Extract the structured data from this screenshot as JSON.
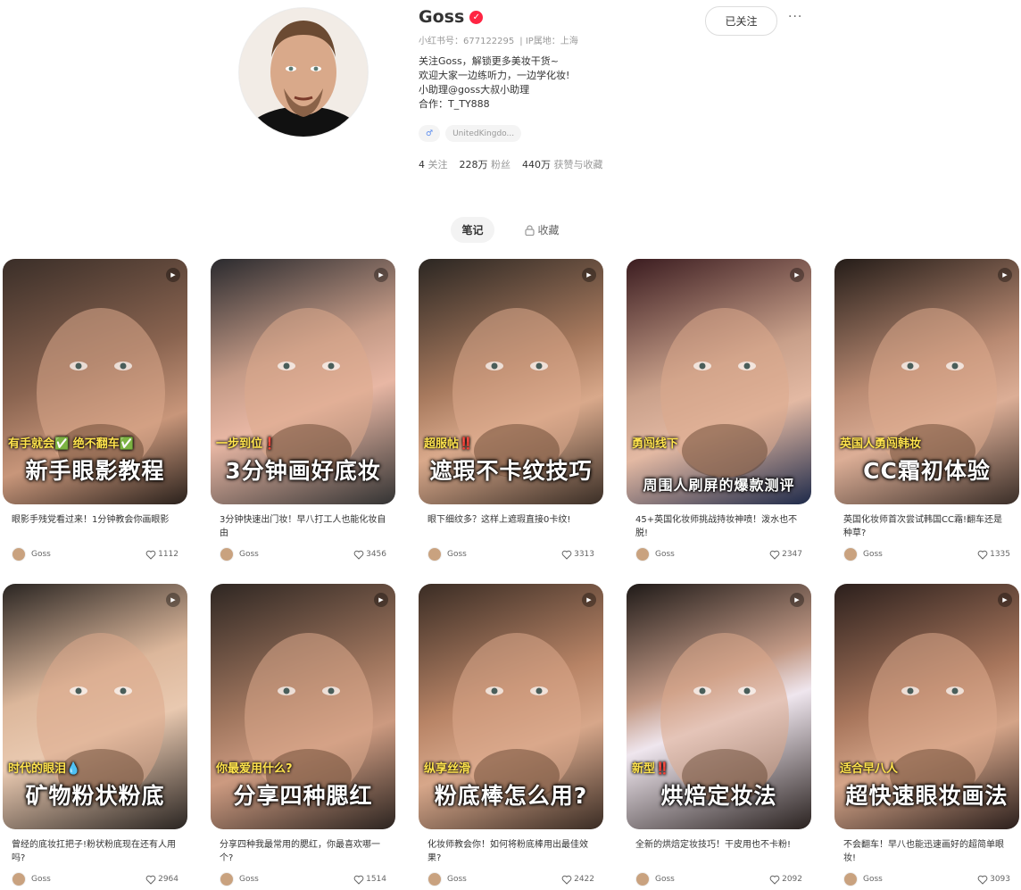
{
  "profile": {
    "name": "Goss",
    "id_label": "小红书号：677122295",
    "ip_label": "IP属地：上海",
    "bio_lines": [
      "关注Goss，解锁更多美妆干货~",
      "欢迎大家一边练听力，一边学化妆!",
      "小助理@goss大叔小助理",
      "合作：T_TY888"
    ],
    "tag": "UnitedKingdo...",
    "following_num": "4",
    "following_label": "关注",
    "fans_num": "228万",
    "fans_label": "粉丝",
    "likes_num": "440万",
    "likes_label": "获赞与收藏",
    "follow_button": "已关注",
    "more": "···"
  },
  "tabs": {
    "notes": "笔记",
    "collect": "收藏"
  },
  "notes": [
    {
      "cap1": "有手就会✅ 绝不翻车✅",
      "cap2": "新手眼影教程",
      "title": "眼影手残党看过来！1分钟教会你画眼影",
      "author": "Goss",
      "likes": "1112"
    },
    {
      "cap1": "一步到位❗",
      "cap2": "3分钟画好底妆",
      "title": "3分钟快速出门妆！早八打工人也能化妆自由",
      "author": "Goss",
      "likes": "3456"
    },
    {
      "cap1": "超服帖‼️",
      "cap2": "遮瑕不卡纹技巧",
      "title": "眼下细纹多？这样上遮瑕直接0卡纹!",
      "author": "Goss",
      "likes": "3313"
    },
    {
      "cap1": "勇闯线下",
      "cap2": "周围人刷屏的爆款测评",
      "title": "45+英国化妆师挑战持妆神喷！泼水也不脱!",
      "author": "Goss",
      "likes": "2347"
    },
    {
      "cap1": "英国人勇闯韩妆",
      "cap2": "CC霜初体验",
      "title": "英国化妆师首次尝试韩国CC霜!翻车还是种草?",
      "author": "Goss",
      "likes": "1335"
    },
    {
      "cap1": "时代的眼泪💧",
      "cap2": "矿物粉状粉底",
      "title": "曾经的底妆扛把子!粉状粉底现在还有人用吗?",
      "author": "Goss",
      "likes": "2964"
    },
    {
      "cap1": "你最爱用什么?",
      "cap2": "分享四种腮红",
      "title": "分享四种我最常用的腮红，你最喜欢哪一个?",
      "author": "Goss",
      "likes": "1514"
    },
    {
      "cap1": "纵享丝滑",
      "cap2": "粉底棒怎么用?",
      "title": "化妆师教会你！如何将粉底棒用出最佳效果?",
      "author": "Goss",
      "likes": "2422"
    },
    {
      "cap1": "新型‼️",
      "cap2": "烘焙定妆法",
      "title": "全新的烘焙定妆技巧！干皮用也不卡粉!",
      "author": "Goss",
      "likes": "2092"
    },
    {
      "cap1": "适合早八人",
      "cap2": "超快速眼妆画法",
      "title": "不会翻车！早八也能迅速画好的超简单眼妆!",
      "author": "Goss",
      "likes": "3093"
    }
  ],
  "colors": {
    "accent": "#ff2442"
  }
}
